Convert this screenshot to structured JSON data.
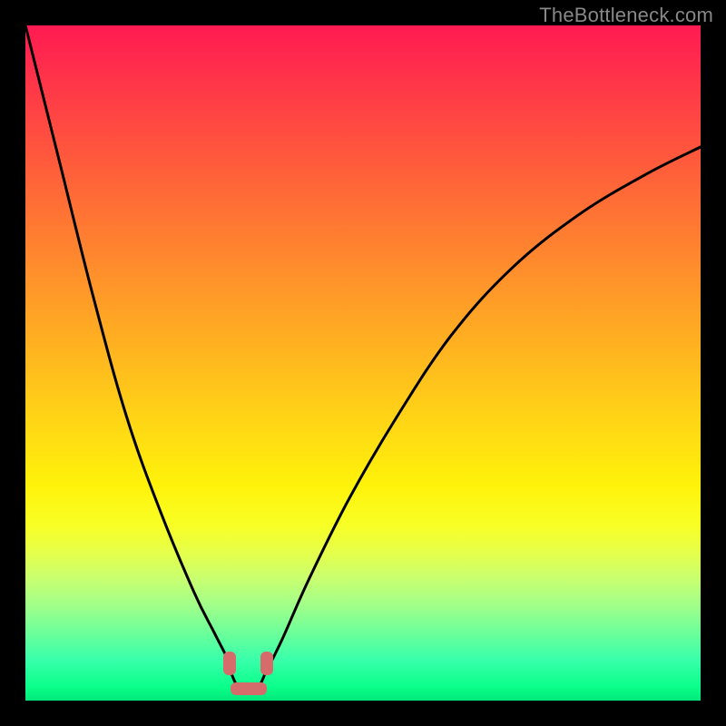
{
  "watermark": "TheBottleneck.com",
  "chart_data": {
    "type": "line",
    "title": "",
    "xlabel": "",
    "ylabel": "",
    "xlim": [
      0,
      1
    ],
    "ylim": [
      0,
      1
    ],
    "grid": false,
    "legend": false,
    "series": [
      {
        "name": "left-branch",
        "x": [
          0.0,
          0.05,
          0.1,
          0.15,
          0.2,
          0.25,
          0.28,
          0.3,
          0.305
        ],
        "y": [
          1.0,
          0.8,
          0.6,
          0.42,
          0.28,
          0.16,
          0.1,
          0.06,
          0.04
        ]
      },
      {
        "name": "right-branch",
        "x": [
          0.355,
          0.38,
          0.42,
          0.48,
          0.55,
          0.63,
          0.72,
          0.82,
          0.92,
          1.0
        ],
        "y": [
          0.04,
          0.09,
          0.18,
          0.3,
          0.42,
          0.54,
          0.64,
          0.72,
          0.78,
          0.82
        ]
      },
      {
        "name": "valley-floor",
        "x": [
          0.305,
          0.315,
          0.33,
          0.345,
          0.355
        ],
        "y": [
          0.04,
          0.02,
          0.015,
          0.02,
          0.04
        ]
      }
    ],
    "markers": [
      {
        "name": "left-cap",
        "x": 0.303,
        "y": 0.055
      },
      {
        "name": "bottom-cap",
        "x": 0.33,
        "y": 0.018
      },
      {
        "name": "right-cap",
        "x": 0.357,
        "y": 0.055
      }
    ],
    "colors": {
      "curve": "#000000",
      "marker": "#d66b6b",
      "gradient_top": "#ff1a52",
      "gradient_mid": "#ffda14",
      "gradient_bottom": "#00e87a",
      "frame": "#000000"
    }
  }
}
